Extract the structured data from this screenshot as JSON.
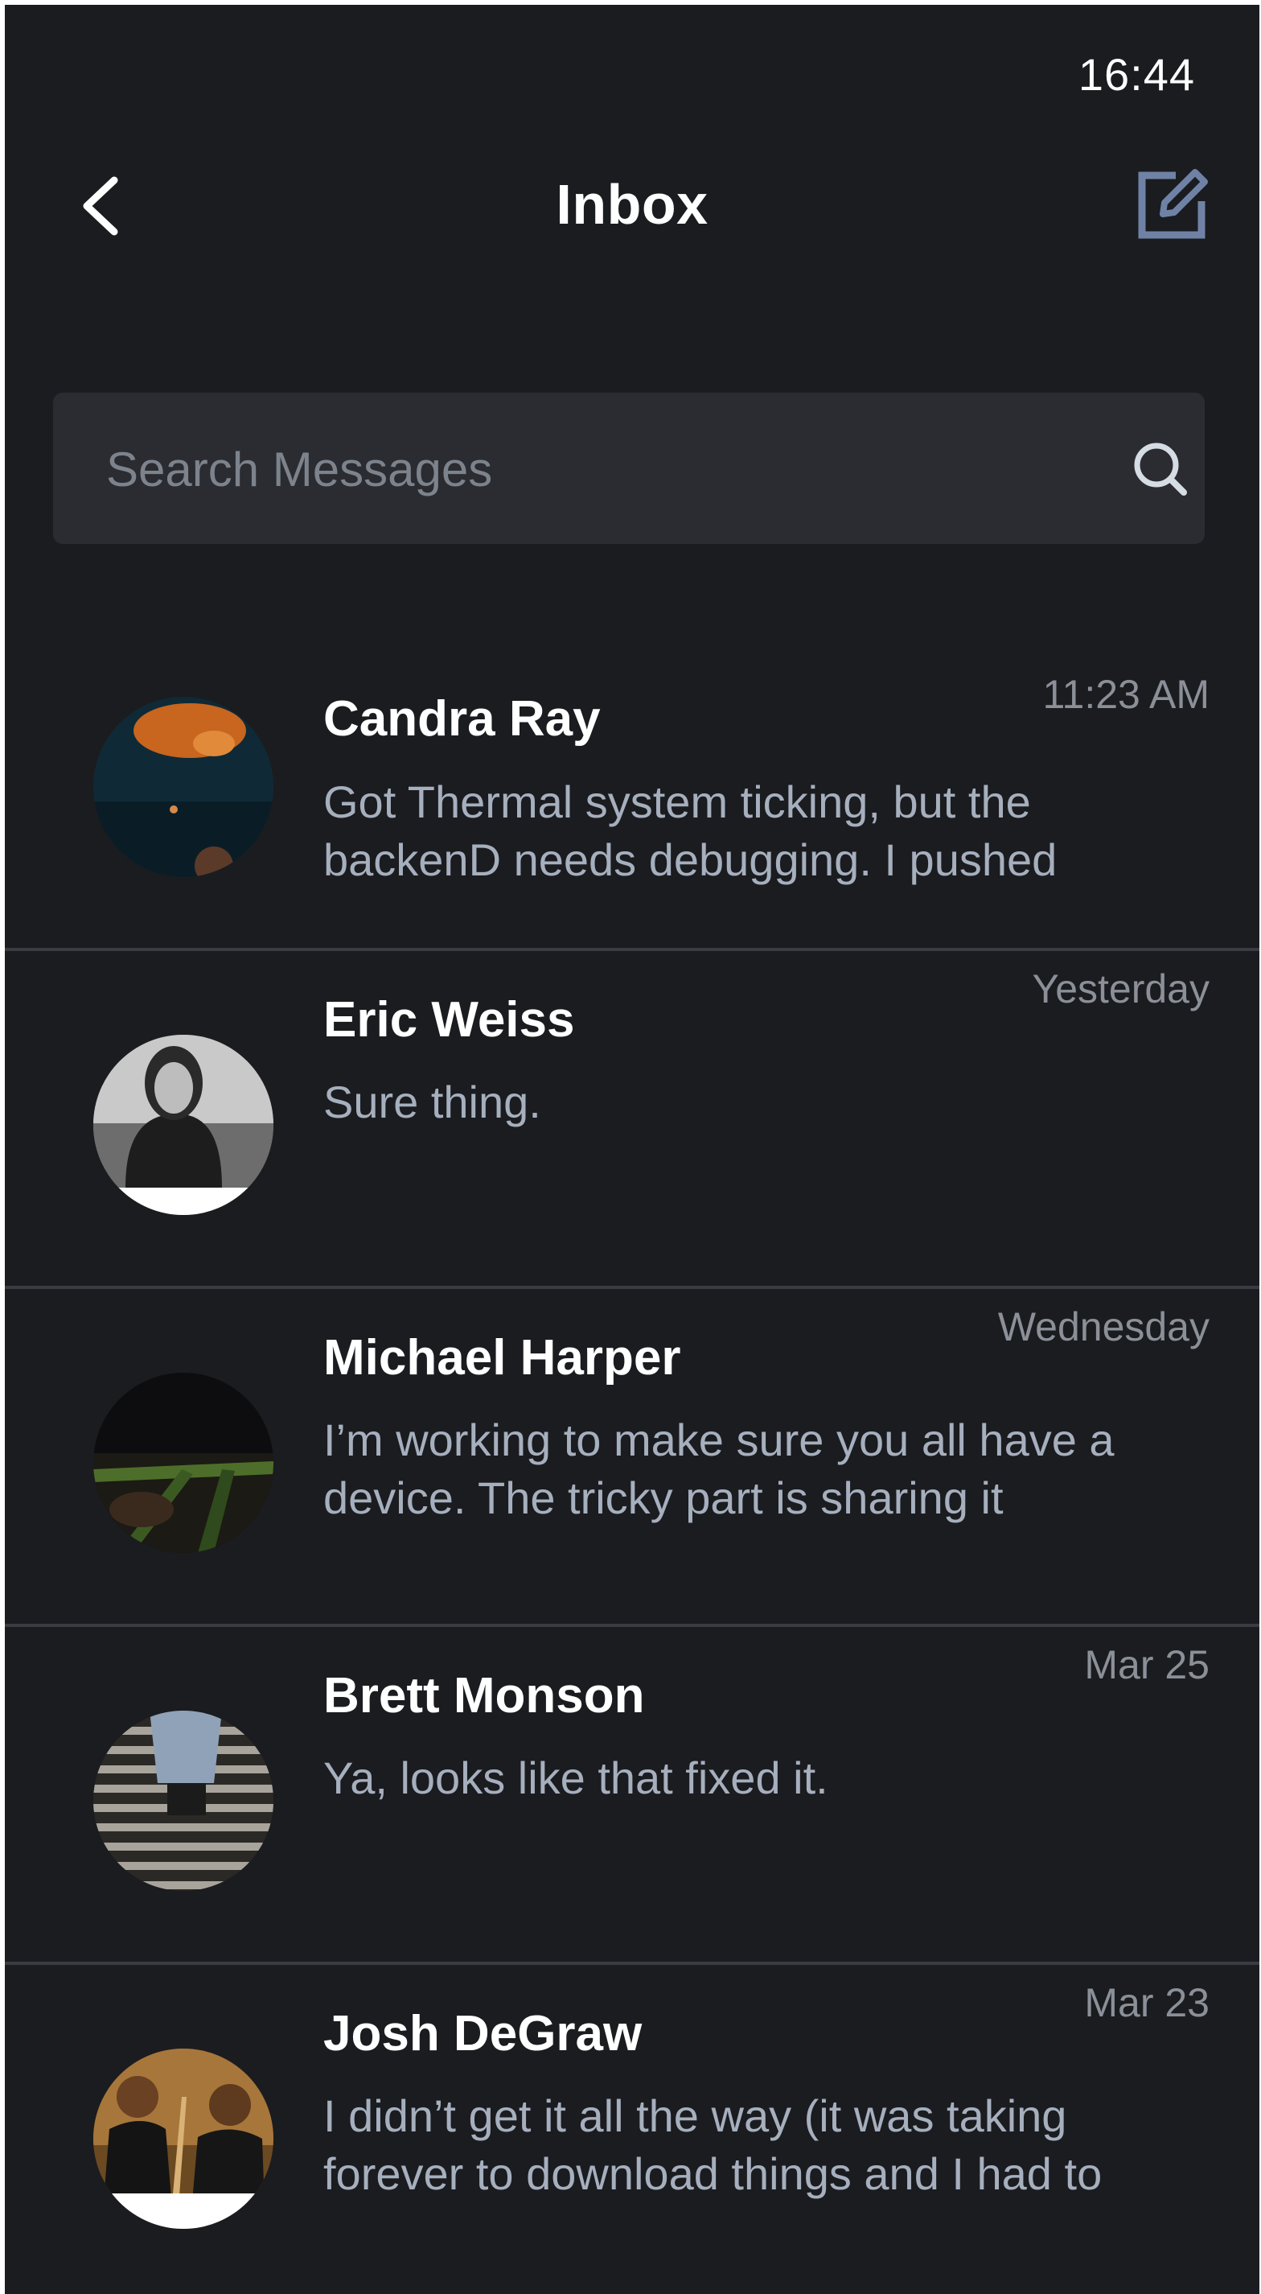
{
  "status_bar": {
    "time": "16:44"
  },
  "header": {
    "title": "Inbox",
    "back_icon": "chevron-left-icon",
    "compose_icon": "compose-icon",
    "compose_color": "#6f82a6"
  },
  "search": {
    "placeholder": "Search Messages",
    "icon": "search-icon"
  },
  "messages": [
    {
      "sender": "Candra Ray",
      "time": "11:23 AM",
      "preview": "Got Thermal system ticking, but the backenD needs debugging. I pushed"
    },
    {
      "sender": "Eric Weiss",
      "time": "Yesterday",
      "preview": "Sure thing."
    },
    {
      "sender": "Michael Harper",
      "time": "Wednesday",
      "preview": "I’m working to make sure you all have a device. The tricky part is sharing it"
    },
    {
      "sender": "Brett Monson",
      "time": "Mar 25",
      "preview": "Ya, looks like that fixed it."
    },
    {
      "sender": "Josh DeGraw",
      "time": "Mar 23",
      "preview": "I didn’t get it all the way (it was taking forever to download things and I had to"
    }
  ],
  "colors": {
    "background": "#1b1c20",
    "search_background": "#2a2c31",
    "divider": "#3a3c42",
    "preview_text": "#a6afbd",
    "time_text": "#8b9098"
  }
}
